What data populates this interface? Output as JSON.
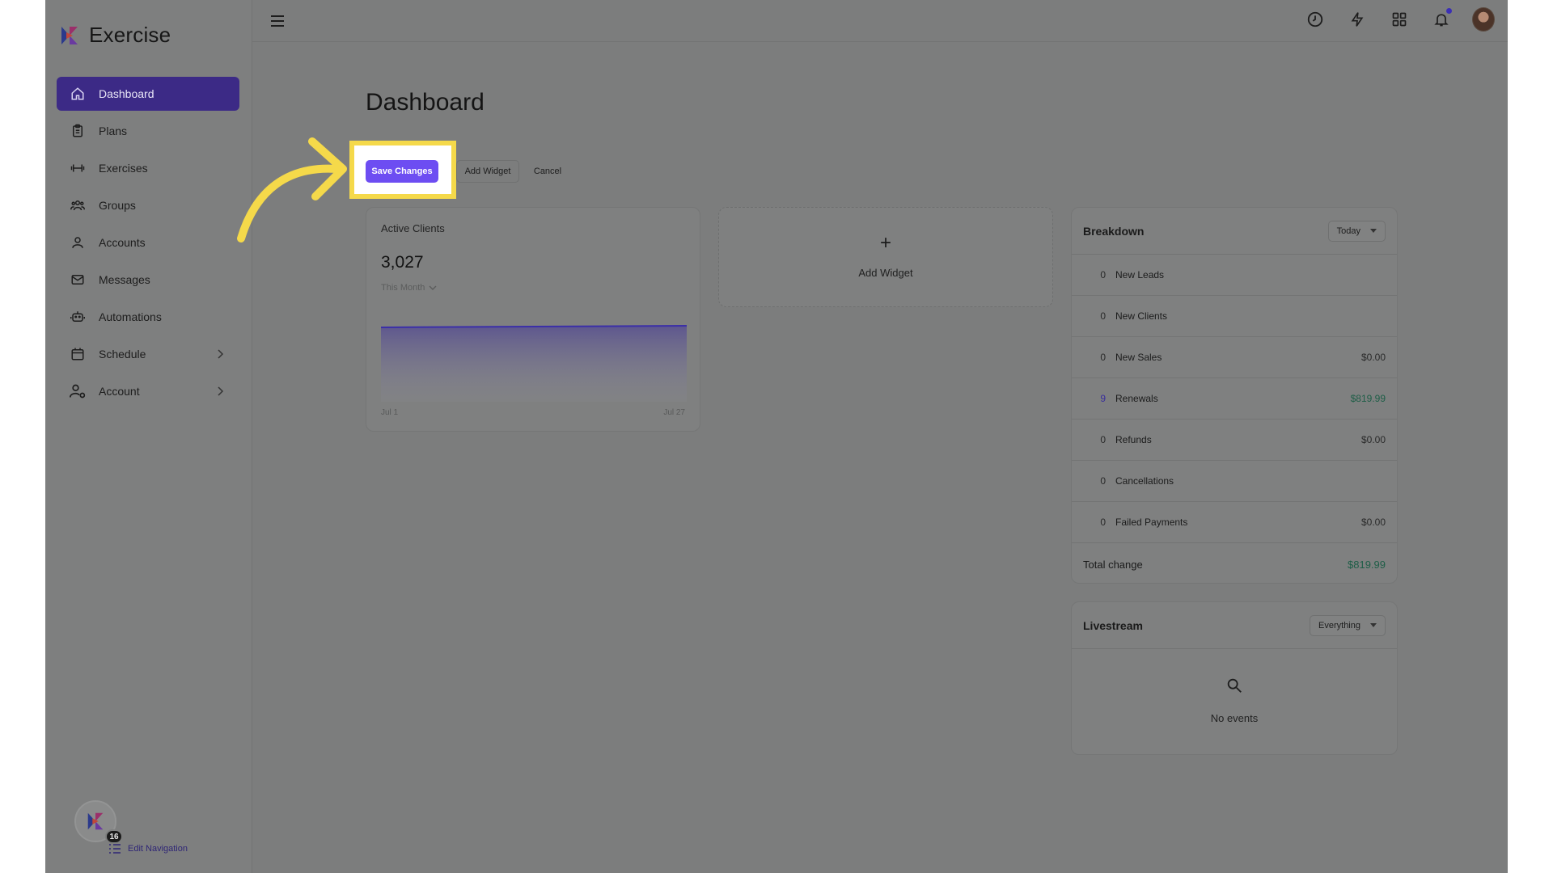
{
  "app": {
    "name": "Exercise"
  },
  "sidebar": {
    "items": [
      {
        "label": "Dashboard",
        "icon": "home-icon",
        "active": true
      },
      {
        "label": "Plans",
        "icon": "clipboard-icon"
      },
      {
        "label": "Exercises",
        "icon": "dumbbell-icon"
      },
      {
        "label": "Groups",
        "icon": "users-icon"
      },
      {
        "label": "Accounts",
        "icon": "user-icon"
      },
      {
        "label": "Messages",
        "icon": "mail-icon"
      },
      {
        "label": "Automations",
        "icon": "robot-icon"
      },
      {
        "label": "Schedule",
        "icon": "calendar-icon",
        "expandable": true
      },
      {
        "label": "Account",
        "icon": "user-gear-icon",
        "expandable": true
      }
    ],
    "badge_count": "16",
    "edit_navigation_label": "Edit Navigation"
  },
  "page": {
    "title": "Dashboard"
  },
  "toolbar": {
    "save_label": "Save Changes",
    "add_widget_label": "Add Widget",
    "cancel_label": "Cancel"
  },
  "active_clients": {
    "title": "Active Clients",
    "value": "3,027",
    "period": "This Month",
    "x_start": "Jul 1",
    "x_end": "Jul 27"
  },
  "add_widget": {
    "label": "Add Widget"
  },
  "breakdown": {
    "title": "Breakdown",
    "filter": "Today",
    "rows": [
      {
        "count": "0",
        "label": "New Leads",
        "amount": ""
      },
      {
        "count": "0",
        "label": "New Clients",
        "amount": ""
      },
      {
        "count": "0",
        "label": "New Sales",
        "amount": "$0.00"
      },
      {
        "count": "9",
        "label": "Renewals",
        "amount": "$819.99",
        "highlight": true
      },
      {
        "count": "0",
        "label": "Refunds",
        "amount": "$0.00"
      },
      {
        "count": "0",
        "label": "Cancellations",
        "amount": ""
      },
      {
        "count": "0",
        "label": "Failed Payments",
        "amount": "$0.00"
      }
    ],
    "total_label": "Total change",
    "total_value": "$819.99"
  },
  "livestream": {
    "title": "Livestream",
    "filter": "Everything",
    "empty_text": "No events"
  },
  "colors": {
    "accent": "#6d4df2",
    "highlight": "#f5d94a",
    "active_nav": "#3c2a86",
    "positive": "#1e5e47"
  }
}
